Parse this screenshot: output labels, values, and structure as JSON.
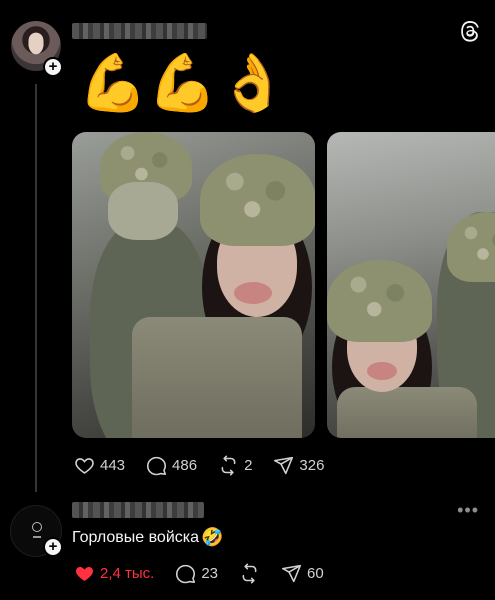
{
  "post": {
    "emojis": "💪💪👌",
    "stats": {
      "likes": "443",
      "comments": "486",
      "reposts": "2",
      "shares": "326"
    }
  },
  "reply": {
    "text": "Горловые войска",
    "emoji": "🤣",
    "stats": {
      "likes": "2,4 тыс.",
      "comments": "23",
      "shares": "60"
    }
  },
  "colors": {
    "like_active": "#ff3040",
    "text": "#f3f5f7",
    "muted": "#cfd2d4"
  },
  "icons": [
    "threads-logo-icon",
    "heart-icon",
    "comment-icon",
    "repost-icon",
    "send-icon",
    "more-icon",
    "plus-icon"
  ]
}
